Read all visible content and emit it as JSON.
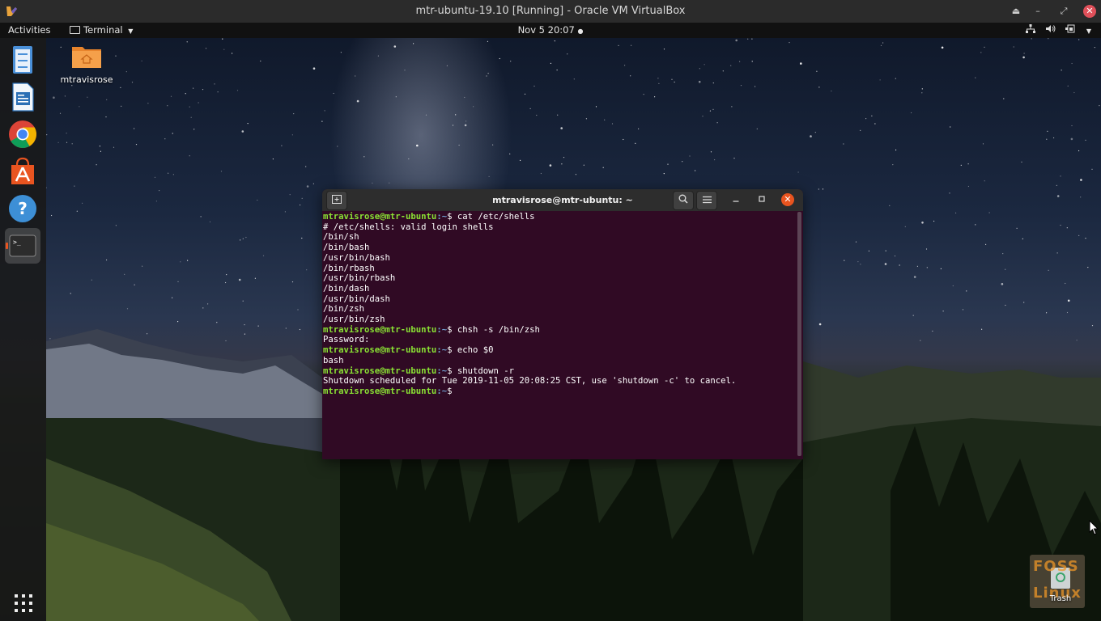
{
  "vbox": {
    "title": "mtr-ubuntu-19.10 [Running] - Oracle VM VirtualBox",
    "controls": {
      "eject": "⏏",
      "minimize": "–",
      "restore": "⤢",
      "close": "✕"
    }
  },
  "topbar": {
    "activities": "Activities",
    "app_menu": "Terminal",
    "clock": "Nov 5  20:07",
    "tray_icons": [
      "network-icon",
      "volume-icon",
      "battery-icon",
      "system-menu-arrow-icon"
    ]
  },
  "dock": {
    "items": [
      {
        "name": "files-icon"
      },
      {
        "name": "libreoffice-writer-icon"
      },
      {
        "name": "chrome-icon"
      },
      {
        "name": "ubuntu-software-icon"
      },
      {
        "name": "help-icon",
        "glyph": "?"
      },
      {
        "name": "terminal-icon",
        "glyph": ">_",
        "running": true
      }
    ]
  },
  "desktop": {
    "home_folder_label": "mtravisrose",
    "trash_label": "Trash",
    "watermark": [
      "FOSS",
      "Linux"
    ]
  },
  "terminal": {
    "title": "mtravisrose@mtr-ubuntu: ~",
    "prompt": "mtravisrose@mtr-ubuntu",
    "prompt_path": ":~",
    "lines": [
      {
        "type": "cmd",
        "text": "$ cat /etc/shells"
      },
      {
        "type": "out",
        "text": "# /etc/shells: valid login shells"
      },
      {
        "type": "out",
        "text": "/bin/sh"
      },
      {
        "type": "out",
        "text": "/bin/bash"
      },
      {
        "type": "out",
        "text": "/usr/bin/bash"
      },
      {
        "type": "out",
        "text": "/bin/rbash"
      },
      {
        "type": "out",
        "text": "/usr/bin/rbash"
      },
      {
        "type": "out",
        "text": "/bin/dash"
      },
      {
        "type": "out",
        "text": "/usr/bin/dash"
      },
      {
        "type": "out",
        "text": "/bin/zsh"
      },
      {
        "type": "out",
        "text": "/usr/bin/zsh"
      },
      {
        "type": "cmd",
        "text": "$ chsh -s /bin/zsh"
      },
      {
        "type": "out",
        "text": "Password:"
      },
      {
        "type": "cmd",
        "text": "$ echo $0"
      },
      {
        "type": "out",
        "text": "bash"
      },
      {
        "type": "cmd",
        "text": "$ shutdown -r"
      },
      {
        "type": "out",
        "text": "Shutdown scheduled for Tue 2019-11-05 20:08:25 CST, use 'shutdown -c' to cancel."
      },
      {
        "type": "cmd",
        "text": "$ "
      }
    ]
  },
  "colors": {
    "terminal_bg": "#300a24",
    "prompt_green": "#8ae234",
    "ubuntu_orange": "#e95420"
  }
}
